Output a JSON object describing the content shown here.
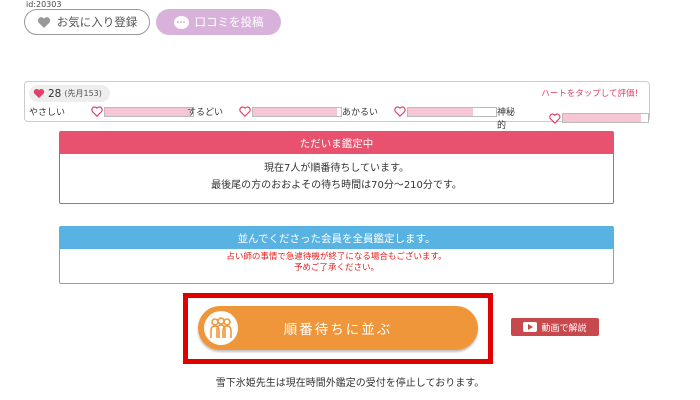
{
  "header": {
    "id_text": "id:20303",
    "favorite_label": "お気に入り登録",
    "review_label": "口コミを投稿"
  },
  "rating": {
    "count": "28",
    "count_note": "(先月153)",
    "tap_hint": "ハートをタップして評価！",
    "meters": [
      {
        "label": "やさしい",
        "level_percent": 97
      },
      {
        "label": "するどい",
        "level_percent": 95
      },
      {
        "label": "あかるい",
        "level_percent": 74
      },
      {
        "label": "神秘的",
        "level_percent": 92
      }
    ]
  },
  "status_panel": {
    "title": "ただいま鑑定中",
    "line1": "現在7人が順番待ちしています。",
    "line2": "最後尾の方のおおよその待ち時間は70分〜210分です。"
  },
  "notice_panel": {
    "title": "並んでくださった会員を全員鑑定します。",
    "line1": "占い師の事情で急遽待機が終了になる場合もございます。",
    "line2": "予めご了承ください。"
  },
  "queue_button": {
    "label": "順番待ちに並ぶ"
  },
  "video_button": {
    "label": "動画で解説"
  },
  "footer_note": "雪下氷姫先生は現在時間外鑑定の受付を停止しております。",
  "colors": {
    "pink": "#e8526f",
    "blue": "#58b3e3",
    "orange": "#f0963a",
    "lavender": "#d9b2dc",
    "highlight": "#e00000"
  }
}
